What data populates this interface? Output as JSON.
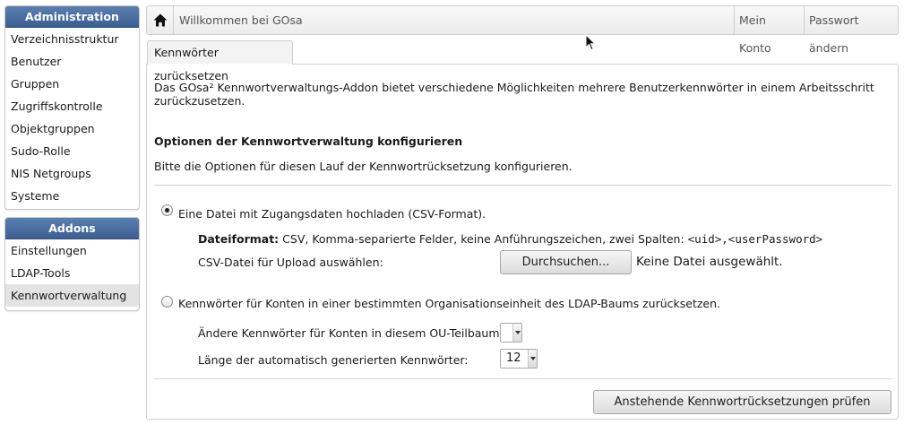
{
  "sidebar": {
    "administration": {
      "title": "Administration",
      "items": [
        "Verzeichnisstruktur",
        "Benutzer",
        "Gruppen",
        "Zugriffskontrolle",
        "Objektgruppen",
        "Sudo-Rolle",
        "NIS Netgroups",
        "Systeme"
      ]
    },
    "addons": {
      "title": "Addons",
      "items": [
        "Einstellungen",
        "LDAP-Tools",
        "Kennwortverwaltung"
      ],
      "active_item": "Kennwortverwaltung"
    }
  },
  "topbar": {
    "home_icon": "home-icon",
    "welcome": "Willkommen bei GOsa",
    "my_account": "Mein Konto",
    "change_password": "Passwort ändern"
  },
  "tab": {
    "label": "Kennwörter zurücksetzen"
  },
  "content": {
    "intro_line1": "Das GOsa² Kennwortverwaltungs-Addon bietet verschiedene Möglichkeiten mehrere Benutzerkennwörter in einem Arbeitsschritt",
    "intro_line2": "zurückzusetzen.",
    "section_title": "Optionen der Kennwortverwaltung konfigurieren",
    "section_desc": "Bitte die Optionen für diesen Lauf der Kennwortrücksetzung konfigurieren.",
    "option_csv": {
      "label": "Eine Datei mit Zugangsdaten hochladen (CSV-Format).",
      "selected": true,
      "format_label": "Dateiformat:",
      "format_text": " CSV, Komma-separierte Felder, keine Anführungszeichen, zwei Spalten: ",
      "format_code": "<uid>,<userPassword>",
      "upload_label": "CSV-Datei für Upload auswählen:",
      "browse_button": "Durchsuchen...",
      "no_file": "Keine Datei ausgewählt."
    },
    "option_ou": {
      "label": "Kennwörter für Konten in einer bestimmten Organisationseinheit des LDAP-Baums zurücksetzen.",
      "selected": false,
      "subtree_label": "Ändere Kennwörter für Konten in diesem OU-Teilbaum:",
      "subtree_value": "",
      "length_label": "Länge der automatisch generierten Kennwörter:",
      "length_value": "12"
    },
    "submit_button": "Anstehende Kennwortrücksetzungen prüfen"
  }
}
